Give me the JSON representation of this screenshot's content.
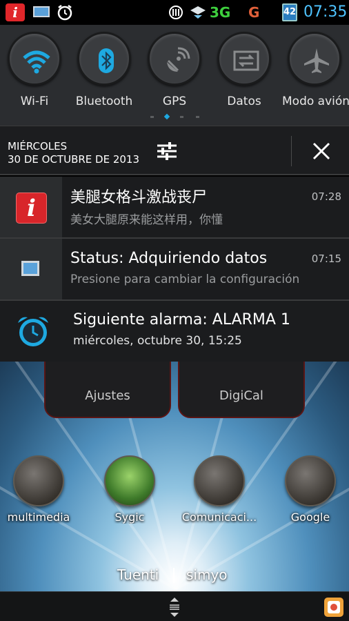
{
  "status_bar": {
    "network_3g": "3G",
    "network_g": "G",
    "battery": "42",
    "time": "07:35"
  },
  "quick_settings": {
    "tiles": [
      {
        "label": "Wi-Fi",
        "icon": "wifi-icon"
      },
      {
        "label": "Bluetooth",
        "icon": "bluetooth-icon"
      },
      {
        "label": "GPS",
        "icon": "gps-icon"
      },
      {
        "label": "Datos",
        "icon": "data-transfer-icon"
      },
      {
        "label": "Modo avión",
        "icon": "airplane-icon"
      }
    ]
  },
  "date": {
    "day": "MIÉRCOLES",
    "full": "30 DE OCTUBRE DE 2013"
  },
  "notifications": [
    {
      "title": "美腿女格斗激战丧尸",
      "text": "美女大腿原来能这样用，你懂",
      "time": "07:28",
      "icon": "app-i-icon"
    },
    {
      "title": "Status: Adquiriendo datos",
      "text": "Presione para cambiar la configuración",
      "time": "07:15",
      "icon": "monitor-icon"
    },
    {
      "title": "Siguiente alarma: ALARMA 1",
      "text": "miércoles, octubre 30, 15:25",
      "icon": "alarm-clock-icon"
    }
  ],
  "home": {
    "folders": [
      "Ajustes",
      "DigiCal"
    ],
    "apps": [
      "multimedia",
      "Sygic",
      "Comunicaci...",
      "Google"
    ],
    "carriers": [
      "Tuenti",
      "simyo"
    ]
  },
  "colors": {
    "accent": "#1ea9e1",
    "time": "#4ec3ff",
    "network_3g": "#3ecf3e",
    "network_g": "#e0603a"
  }
}
